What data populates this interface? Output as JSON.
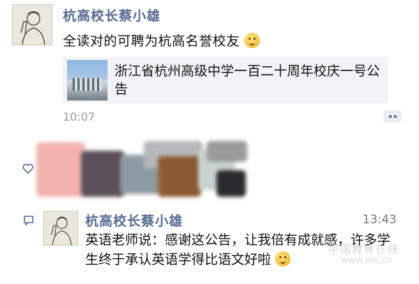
{
  "post": {
    "author": "杭高校长蔡小雄",
    "text": "全读对的可聘为杭高名誉校友",
    "link_title": "浙江省杭州高级中学一百二十周年校庆一号公告",
    "time": "10:07"
  },
  "comment": {
    "author": "杭高校长蔡小雄",
    "time": "13:43",
    "text": "英语老师说：感谢这公告，让我倍有成就感，许多学生终于承认英语学得比语文好啦"
  },
  "watermark": {
    "line1": "中国教育在线",
    "line2": "www.eol.cn"
  },
  "icons": {
    "avatar": "avatar-portrait",
    "emoji": "smirk-emoji",
    "more": "ellipsis-icon",
    "like": "heart-icon",
    "comment": "comment-bubble-icon"
  },
  "colors": {
    "name": "#576b95",
    "time": "#999999",
    "card_bg": "#f3f3f5",
    "interaction_bg": "#f3f3f5"
  }
}
